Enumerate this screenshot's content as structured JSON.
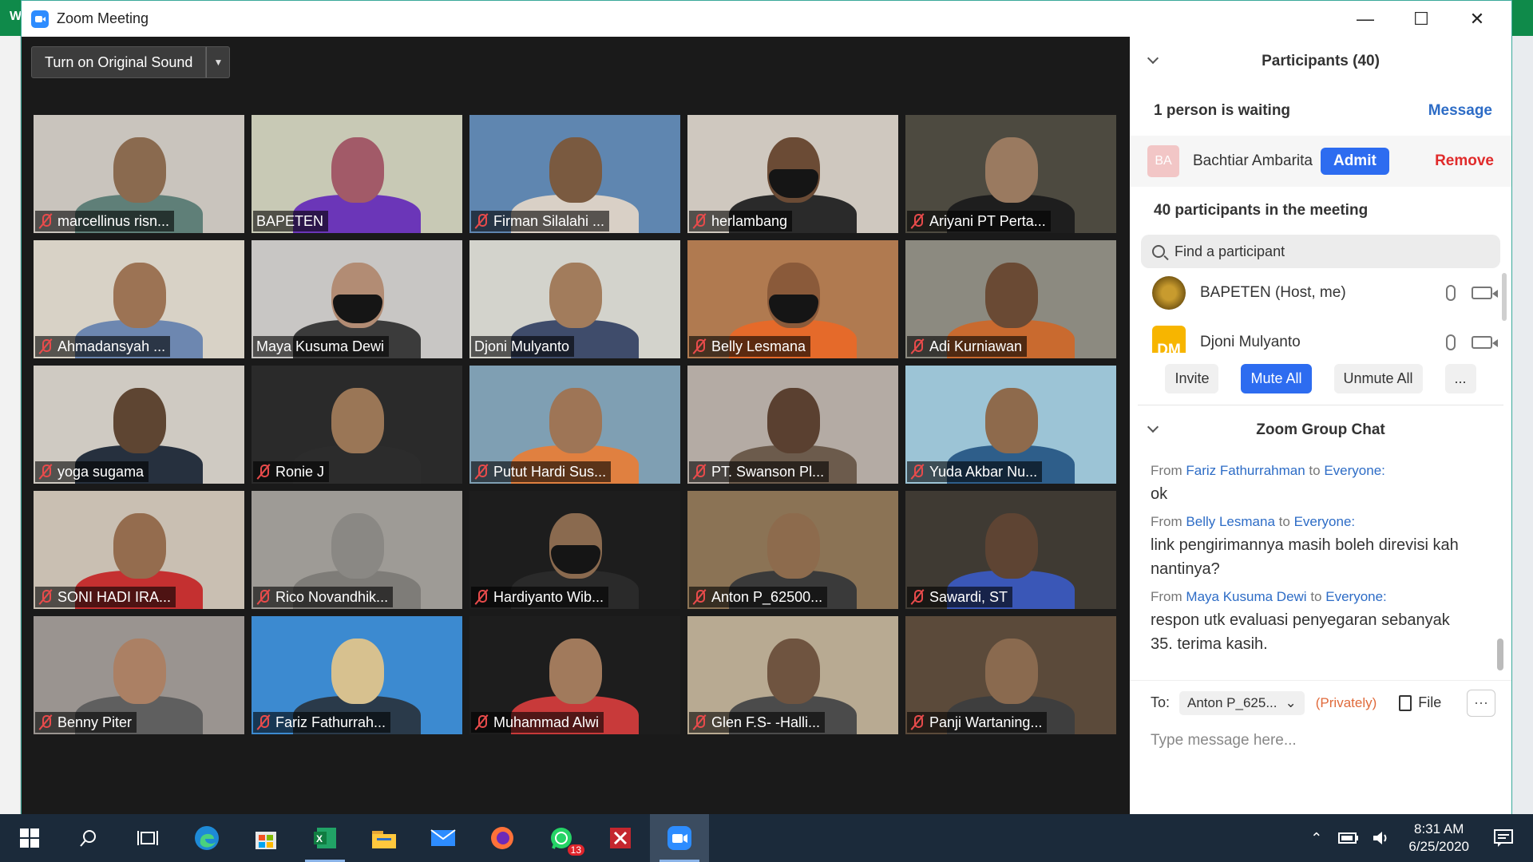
{
  "window": {
    "title": "Zoom Meeting",
    "minimize": "—",
    "maximize": "☐",
    "close": "✕"
  },
  "desktop": {
    "left_letter": "W"
  },
  "video": {
    "sound_button": "Turn on Original Sound",
    "tiles": [
      {
        "name": "marcellinus risn...",
        "bg": "#c9c4bd",
        "skin": "#8a6a4f",
        "shirt": "#5f7f78",
        "muted": true
      },
      {
        "name": "BAPETEN",
        "bg": "#c8c9b5",
        "skin": "#a25a68",
        "shirt": "#6b36b8",
        "muted": false,
        "active": true
      },
      {
        "name": "Firman Silalahi ...",
        "bg": "#5f86b0",
        "skin": "#7a5a40",
        "shirt": "#d9d0c6",
        "muted": true
      },
      {
        "name": "herlambang",
        "bg": "#cfc8bf",
        "skin": "#6b4b35",
        "shirt": "#2a2a2a",
        "muted": true,
        "mask": true
      },
      {
        "name": "Ariyani PT Perta...",
        "bg": "#4d4a40",
        "skin": "#9a7a60",
        "shirt": "#1e1e1e",
        "muted": true
      },
      {
        "name": "Ahmadansyah ...",
        "bg": "#d8d2c6",
        "skin": "#9c7354",
        "shirt": "#6d87b0",
        "muted": true
      },
      {
        "name": "Maya Kusuma Dewi",
        "bg": "#c8c6c4",
        "skin": "#b28c74",
        "shirt": "#3b3b3b",
        "muted": false,
        "mask": true
      },
      {
        "name": "Djoni Mulyanto",
        "bg": "#d3d3cc",
        "skin": "#a27c5c",
        "shirt": "#3f4c6b",
        "muted": false
      },
      {
        "name": "Belly Lesmana",
        "bg": "#b07a50",
        "skin": "#8a5a3a",
        "shirt": "#e56a2a",
        "muted": true,
        "mask": true
      },
      {
        "name": "Adi Kurniawan",
        "bg": "#8c8a80",
        "skin": "#6a4a34",
        "shirt": "#c96a2f",
        "muted": true
      },
      {
        "name": "yoga sugama",
        "bg": "#cfcac2",
        "skin": "#5e4532",
        "shirt": "#26303e",
        "muted": true
      },
      {
        "name": "Ronie J",
        "bg": "#2a2a2a",
        "skin": "#9a7656",
        "shirt": "#2c2c2c",
        "muted": true
      },
      {
        "name": "Putut Hardi Sus...",
        "bg": "#7f9fb3",
        "skin": "#9e7556",
        "shirt": "#e08040",
        "muted": true
      },
      {
        "name": "PT. Swanson Pl...",
        "bg": "#b4aba4",
        "skin": "#5a4030",
        "shirt": "#6c5b4c",
        "muted": true
      },
      {
        "name": "Yuda Akbar Nu...",
        "bg": "#9cc4d6",
        "skin": "#8e6a4c",
        "shirt": "#2e5e8a",
        "muted": true
      },
      {
        "name": "SONI HADI IRA...",
        "bg": "#c9bfb2",
        "skin": "#946c4e",
        "shirt": "#c43030",
        "muted": true
      },
      {
        "name": "Rico Novandhik...",
        "bg": "#9e9b96",
        "skin": "#8a8884",
        "shirt": "#7e7c78",
        "muted": true
      },
      {
        "name": "Hardiyanto Wib...",
        "bg": "#1d1d1d",
        "skin": "#8a6a4f",
        "shirt": "#2a2a2a",
        "muted": true,
        "mask": true
      },
      {
        "name": "Anton P_62500...",
        "bg": "#8b7355",
        "skin": "#8d6b4d",
        "shirt": "#3a3a3a",
        "muted": true
      },
      {
        "name": "Sawardi, ST",
        "bg": "#3f3a33",
        "skin": "#5e4433",
        "shirt": "#3a57b7",
        "muted": true
      },
      {
        "name": "Benny Piter",
        "bg": "#9a9490",
        "skin": "#ab8064",
        "shirt": "#5f5f5f",
        "muted": true
      },
      {
        "name": "Fariz Fathurrah...",
        "bg": "#3c8ad0",
        "skin": "#d7c18f",
        "shirt": "#2a3a4a",
        "muted": true
      },
      {
        "name": "Muhammad Alwi",
        "bg": "#1d1d1d",
        "skin": "#a17a5c",
        "shirt": "#c83a3a",
        "muted": true
      },
      {
        "name": "Glen F.S- -Halli...",
        "bg": "#b8aa92",
        "skin": "#6f5440",
        "shirt": "#4b4b4b",
        "muted": true
      },
      {
        "name": "Panji Wartaning...",
        "bg": "#5b4a3a",
        "skin": "#8a6a4f",
        "shirt": "#3e3e3e",
        "muted": true
      }
    ]
  },
  "participants": {
    "title": "Participants (40)",
    "waiting_text": "1 person is waiting",
    "message_link": "Message",
    "waiting_person": {
      "initials": "BA",
      "name": "Bachtiar Ambarita",
      "admit": "Admit",
      "remove": "Remove"
    },
    "in_meeting": "40 participants in the meeting",
    "search_placeholder": "Find a participant",
    "list": [
      {
        "name": "BAPETEN (Host, me)",
        "avatar": "emblem"
      },
      {
        "name": "Djoni Mulyanto",
        "avatar": "DM"
      }
    ],
    "buttons": {
      "invite": "Invite",
      "mute_all": "Mute All",
      "unmute_all": "Unmute All",
      "more": "..."
    }
  },
  "chat": {
    "title": "Zoom Group Chat",
    "messages": [
      {
        "from": "Fariz Fathurrahman",
        "to": "Everyone:",
        "text": "ok"
      },
      {
        "from": "Belly Lesmana",
        "to": "Everyone:",
        "text": "link pengirimannya masih boleh direvisi kah nantinya?"
      },
      {
        "from": "Maya Kusuma Dewi",
        "to": "Everyone:",
        "text": "respon utk evaluasi penyegaran sebanyak 35. terima kasih."
      }
    ],
    "from_word": "From",
    "to_word": "to",
    "to_label": "To:",
    "to_select": "Anton P_625...",
    "privately": "(Privately)",
    "file_label": "File",
    "more": "···",
    "input_placeholder": "Type message here..."
  },
  "taskbar": {
    "time": "8:31 AM",
    "date": "6/25/2020",
    "whatsapp_badge": "13"
  }
}
